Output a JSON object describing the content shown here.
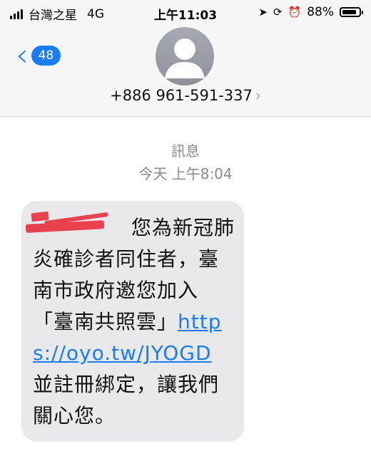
{
  "status_bar": {
    "carrier": "台灣之星",
    "network": "4G",
    "time": "上午11:03",
    "location_icon": "location-arrow-icon",
    "rotation_lock_icon": "rotation-lock-icon",
    "alarm_icon": "alarm-icon",
    "battery_percent": "88%",
    "battery_level": 0.88
  },
  "header": {
    "back_badge": "48",
    "contact_number": "+886 961-591-337",
    "chevron": "›"
  },
  "thread": {
    "label": "訊息",
    "timestamp": "今天 上午8:04"
  },
  "message": {
    "text_before": "您為新冠肺炎確診者同住者，臺南市政府邀您加入「臺南共照雲」",
    "link": "https://oyo.tw/JYOGD",
    "text_after": " 並註冊綁定，讓我們關心您。"
  }
}
